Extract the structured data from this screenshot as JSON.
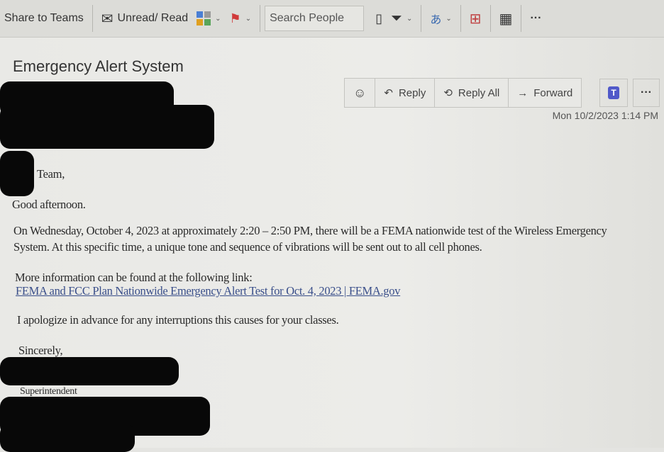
{
  "toolbar": {
    "share_to_teams": "Share to Teams",
    "unread_read": "Unread/ Read",
    "search_placeholder": "Search People",
    "more": "···"
  },
  "email": {
    "subject": "Emergency Alert System",
    "actions": {
      "reply": "Reply",
      "reply_all": "Reply All",
      "forward": "Forward",
      "more": "···"
    },
    "date": "Mon 10/2/2023 1:14 PM",
    "greeting": "Team,",
    "opening": "Good afternoon.",
    "paragraph1_line1": "On Wednesday, October 4, 2023 at approximately 2:20 – 2:50 PM, there will be a FEMA nationwide test of the Wireless Emergency",
    "paragraph1_line2": "System. At this specific time, a unique tone and sequence of vibrations will be sent out to all cell phones.",
    "more_info": "More information can be found at the following link:",
    "link": "FEMA and FCC Plan Nationwide Emergency Alert Test for Oct. 4, 2023 | FEMA.gov",
    "apology": "I apologize in advance for any interruptions this causes for your classes.",
    "closing": "Sincerely,",
    "title": "Superintendent"
  }
}
